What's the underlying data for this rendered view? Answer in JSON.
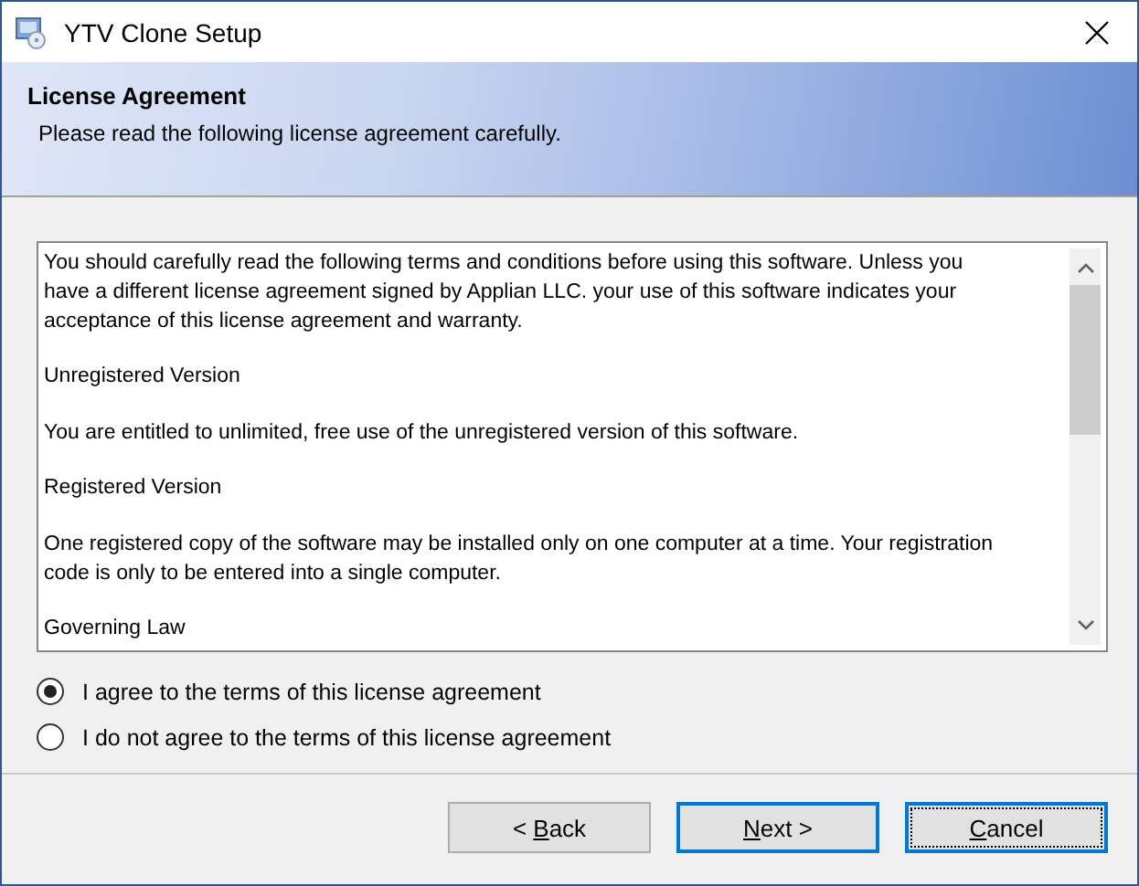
{
  "window": {
    "title": "YTV Clone Setup"
  },
  "header": {
    "title": "License Agreement",
    "subtitle": "Please read the following license agreement carefully."
  },
  "license_text": [
    "You should carefully read the following terms and conditions before using this software. Unless you have a different license agreement signed by Applian LLC. your use of this software indicates your acceptance of this license agreement and warranty.",
    "Unregistered Version",
    "You are entitled to unlimited, free use of the unregistered version of this software.",
    "Registered Version",
    "One registered copy of the software may be installed only on one computer at a time.  Your registration code is only to be entered into a single computer.",
    "Governing Law"
  ],
  "options": [
    {
      "label": "I agree to the terms of this license agreement",
      "selected": true
    },
    {
      "label": "I do not agree to the terms of this license agreement",
      "selected": false
    }
  ],
  "buttons": [
    {
      "pre": "< ",
      "key": "B",
      "post": "ack",
      "default": false,
      "focused": false
    },
    {
      "key": "N",
      "post": "ext >",
      "default": true,
      "focused": false
    },
    {
      "key": "C",
      "post": "ancel",
      "default": false,
      "focused": true
    }
  ]
}
